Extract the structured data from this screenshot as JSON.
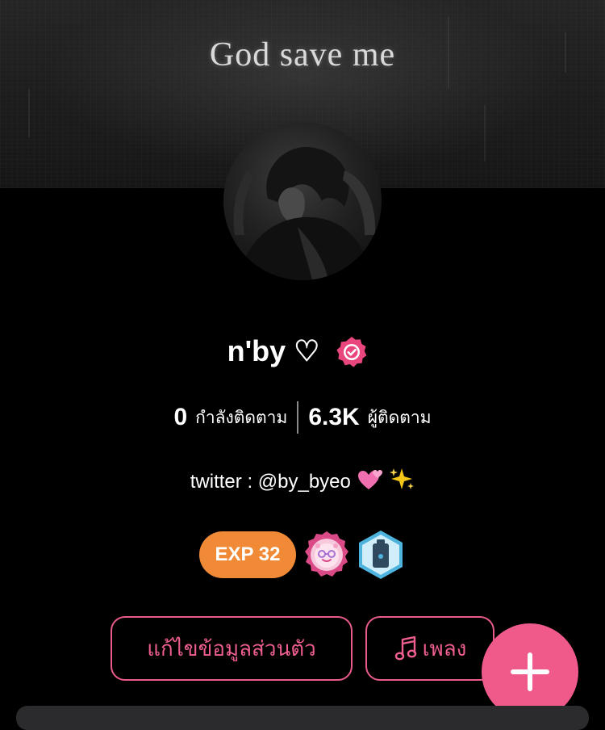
{
  "cover": {
    "text": "God save me"
  },
  "profile": {
    "display_name": "n'by ♡",
    "verified": true,
    "bio_prefix": "twitter : @by_byeo"
  },
  "stats": {
    "following_count": "0",
    "following_label": "กำลังติดตาม",
    "followers_count": "6.3K",
    "followers_label": "ผู้ติดตาม"
  },
  "badges": {
    "exp_label": "EXP 32",
    "items": [
      "pink-flower-badge",
      "blue-hexagon-badge"
    ]
  },
  "actions": {
    "edit_profile_label": "แก้ไขข้อมูลส่วนตัว",
    "music_label": "เพลง"
  },
  "colors": {
    "accent_pink": "#ef5a8b",
    "exp_orange": "#f08a36",
    "background": "#000000"
  },
  "icons": {
    "verified": "verified-badge-icon",
    "music": "music-note-icon",
    "fab": "plus-icon"
  }
}
